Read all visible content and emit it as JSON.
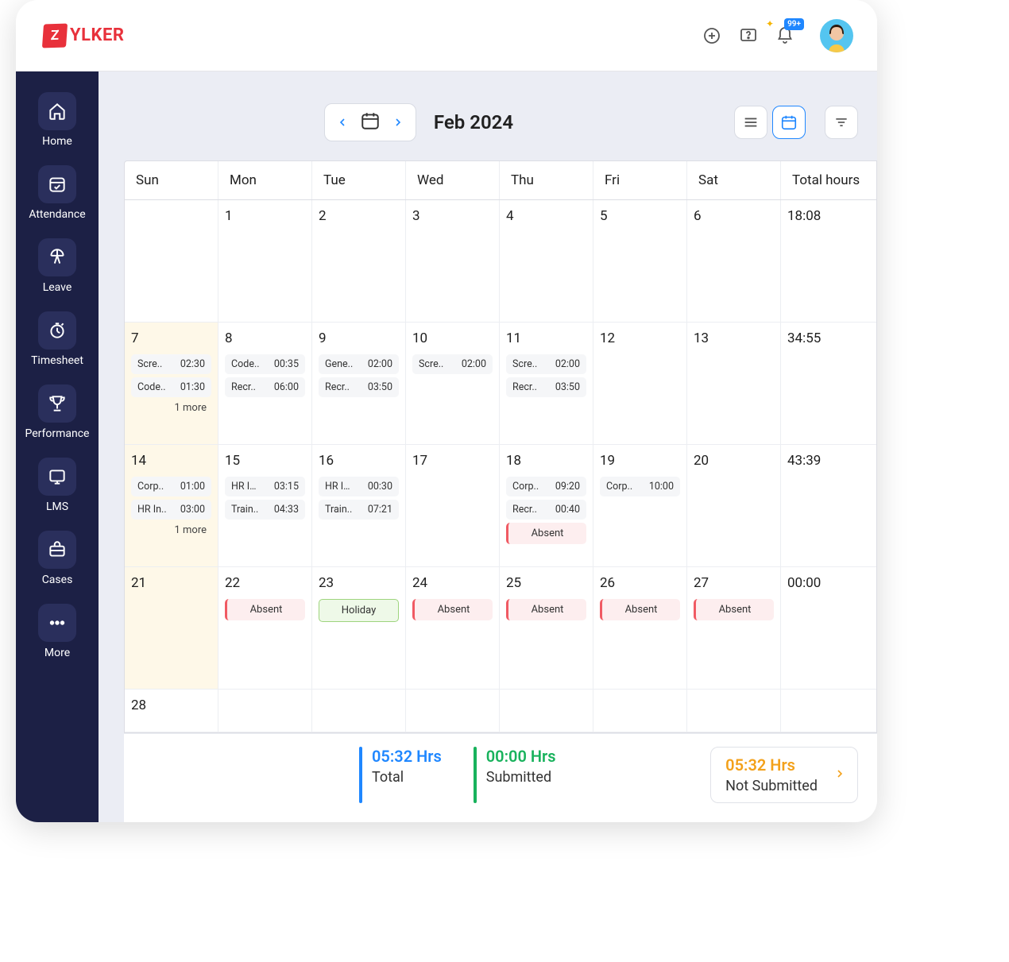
{
  "brand": {
    "badge": "Z",
    "name": "YLKER"
  },
  "notifications": {
    "badge": "99+"
  },
  "sidebar": {
    "items": [
      {
        "label": "Home"
      },
      {
        "label": "Attendance"
      },
      {
        "label": "Leave"
      },
      {
        "label": "Timesheet"
      },
      {
        "label": "Performance"
      },
      {
        "label": "LMS"
      },
      {
        "label": "Cases"
      },
      {
        "label": "More"
      }
    ]
  },
  "period": "Feb 2024",
  "days": [
    "Sun",
    "Mon",
    "Tue",
    "Wed",
    "Thu",
    "Fri",
    "Sat",
    "Total hours"
  ],
  "weeks": [
    {
      "cells": [
        {
          "num": ""
        },
        {
          "num": "1"
        },
        {
          "num": "2"
        },
        {
          "num": "3"
        },
        {
          "num": "4"
        },
        {
          "num": "5"
        },
        {
          "num": "6"
        }
      ],
      "total": "18:08"
    },
    {
      "cells": [
        {
          "num": "7",
          "hl": true,
          "entries": [
            {
              "t": "Scre..",
              "d": "02:30"
            },
            {
              "t": "Code..",
              "d": "01:30"
            }
          ],
          "more": "1 more"
        },
        {
          "num": "8",
          "entries": [
            {
              "t": "Code..",
              "d": "00:35"
            },
            {
              "t": "Recr..",
              "d": "06:00"
            }
          ]
        },
        {
          "num": "9",
          "entries": [
            {
              "t": "Gene..",
              "d": "02:00"
            },
            {
              "t": "Recr..",
              "d": "03:50"
            }
          ]
        },
        {
          "num": "10",
          "entries": [
            {
              "t": "Scre..",
              "d": "02:00"
            }
          ]
        },
        {
          "num": "11",
          "entries": [
            {
              "t": "Scre..",
              "d": "02:00"
            },
            {
              "t": "Recr..",
              "d": "03:50"
            }
          ]
        },
        {
          "num": "12"
        },
        {
          "num": "13"
        }
      ],
      "total": "34:55"
    },
    {
      "cells": [
        {
          "num": "14",
          "hl": true,
          "entries": [
            {
              "t": "Corp..",
              "d": "01:00"
            },
            {
              "t": "HR In..",
              "d": "03:00"
            }
          ],
          "more": "1 more"
        },
        {
          "num": "15",
          "entries": [
            {
              "t": "HR Int..",
              "d": "03:15"
            },
            {
              "t": "Train..",
              "d": "04:33"
            }
          ]
        },
        {
          "num": "16",
          "entries": [
            {
              "t": "HR Int..",
              "d": "00:30"
            },
            {
              "t": "Train..",
              "d": "07:21"
            }
          ]
        },
        {
          "num": "17"
        },
        {
          "num": "18",
          "entries": [
            {
              "t": "Corp..",
              "d": "09:20"
            },
            {
              "t": "Recr..",
              "d": "00:40"
            }
          ],
          "status": {
            "type": "absent",
            "text": "Absent"
          }
        },
        {
          "num": "19",
          "entries": [
            {
              "t": "Corp..",
              "d": "10:00"
            }
          ]
        },
        {
          "num": "20"
        }
      ],
      "total": "43:39"
    },
    {
      "cells": [
        {
          "num": "21",
          "hl": true
        },
        {
          "num": "22",
          "status": {
            "type": "absent",
            "text": "Absent"
          }
        },
        {
          "num": "23",
          "status": {
            "type": "holiday",
            "text": "Holiday"
          }
        },
        {
          "num": "24",
          "status": {
            "type": "absent",
            "text": "Absent"
          }
        },
        {
          "num": "25",
          "status": {
            "type": "absent",
            "text": "Absent"
          }
        },
        {
          "num": "26",
          "status": {
            "type": "absent",
            "text": "Absent"
          }
        },
        {
          "num": "27",
          "status": {
            "type": "absent",
            "text": "Absent"
          }
        }
      ],
      "total": "00:00"
    },
    {
      "cells": [
        {
          "num": "28"
        },
        {
          "num": ""
        },
        {
          "num": ""
        },
        {
          "num": ""
        },
        {
          "num": ""
        },
        {
          "num": ""
        },
        {
          "num": ""
        }
      ],
      "total": ""
    }
  ],
  "footer": {
    "total": {
      "value": "05:32 Hrs",
      "label": "Total"
    },
    "submitted": {
      "value": "00:00 Hrs",
      "label": "Submitted"
    },
    "notsub": {
      "value": "05:32 Hrs",
      "label": "Not Submitted"
    }
  }
}
